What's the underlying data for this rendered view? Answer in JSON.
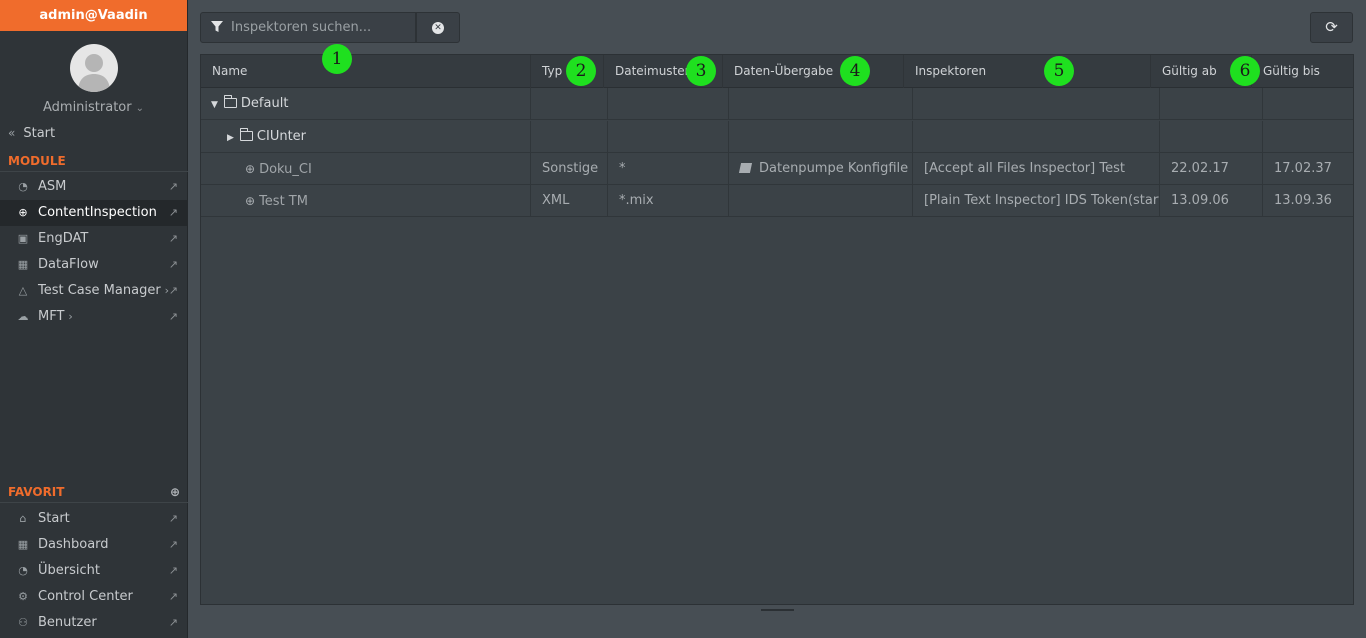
{
  "sidebar": {
    "user": "admin@Vaadin",
    "role": "Administrator",
    "start_link": "Start",
    "module_title": "MODULE",
    "modules": [
      {
        "label": "ASM",
        "icon": "dashboard-gauge-icon"
      },
      {
        "label": "ContentInspection",
        "icon": "search-plus-icon",
        "active": true
      },
      {
        "label": "EngDAT",
        "icon": "image-icon"
      },
      {
        "label": "DataFlow",
        "icon": "dataflow-icon"
      },
      {
        "label": "Test Case Manager",
        "icon": "flask-icon",
        "has_submenu": true
      },
      {
        "label": "MFT",
        "icon": "cloud-icon",
        "has_submenu": true
      }
    ],
    "favorites_title": "FAVORIT",
    "favorites": [
      {
        "label": "Start",
        "icon": "home-icon"
      },
      {
        "label": "Dashboard",
        "icon": "grid-icon"
      },
      {
        "label": "Übersicht",
        "icon": "pie-chart-icon"
      },
      {
        "label": "Control Center",
        "icon": "cogs-icon"
      },
      {
        "label": "Benutzer",
        "icon": "users-icon"
      }
    ]
  },
  "search": {
    "placeholder": "Inspektoren suchen...",
    "value": ""
  },
  "grid": {
    "columns": [
      "Name",
      "Typ",
      "Dateimuster",
      "Daten-Übergabe",
      "Inspektoren",
      "Gültig ab",
      "Gültig bis"
    ],
    "rows": [
      {
        "name": "Default",
        "type": "folder",
        "expanded": true,
        "level": 0,
        "typ": "",
        "dateimuster": "",
        "daten_uebergabe": "",
        "inspektoren": "",
        "gueltig_ab": "",
        "gueltig_bis": ""
      },
      {
        "name": "CIUnter",
        "type": "folder",
        "expanded": false,
        "level": 1,
        "typ": "",
        "dateimuster": "",
        "daten_uebergabe": "",
        "inspektoren": "",
        "gueltig_ab": "",
        "gueltig_bis": ""
      },
      {
        "name": "Doku_CI",
        "type": "inspection",
        "level": 2,
        "typ": "Sonstige",
        "dateimuster": "*",
        "daten_uebergabe": "Datenpumpe Konfigfile",
        "inspektoren": "[Accept all Files Inspector] Test",
        "gueltig_ab": "22.02.17",
        "gueltig_bis": "17.02.37"
      },
      {
        "name": "Test TM",
        "type": "inspection",
        "level": 2,
        "typ": "XML",
        "dateimuster": "*.mix",
        "daten_uebergabe": "",
        "inspektoren": "[Plain Text Inspector] IDS Token(starts w",
        "gueltig_ab": "13.09.06",
        "gueltig_bis": "13.09.36"
      }
    ]
  },
  "annotations": [
    "1",
    "2",
    "3",
    "4",
    "5",
    "6"
  ],
  "colors": {
    "accent": "#f06c2c",
    "badge": "#1fe01f",
    "sidebar_bg": "#2f3438",
    "main_bg": "#474e54"
  }
}
